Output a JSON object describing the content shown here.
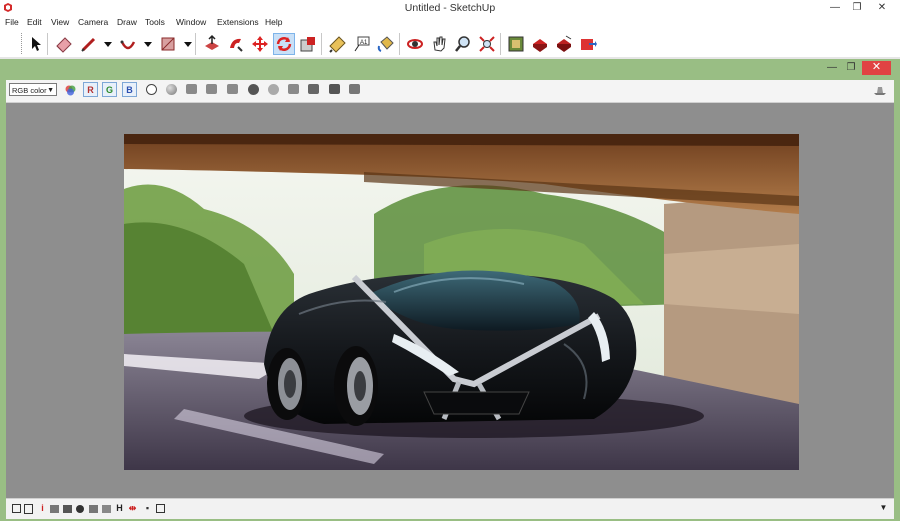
{
  "window": {
    "title": "Untitled - SketchUp",
    "minimize": "—",
    "restore": "❐",
    "close": "✕"
  },
  "menu": [
    "File",
    "Edit",
    "View",
    "Camera",
    "Draw",
    "Tools",
    "Window",
    "Extensions",
    "Help"
  ],
  "toolbar": {
    "tools": [
      "select",
      "eraser",
      "line",
      "arc",
      "rectangle",
      "push-pull",
      "follow-me",
      "move",
      "rotate",
      "scale",
      "tape-measure",
      "text",
      "paint-bucket",
      "orbit",
      "pan",
      "zoom",
      "zoom-extents",
      "warehouse",
      "share-model",
      "components",
      "extension-warehouse"
    ],
    "active": "rotate"
  },
  "child_window": {
    "minimize": "—",
    "restore": "❐",
    "close": "✕"
  },
  "color_toolbar": {
    "mode_select": "RGB color",
    "channels": [
      "R",
      "G",
      "B"
    ]
  },
  "status_icons": [
    "H"
  ],
  "colors": {
    "child_frame": "#99be84",
    "workspace": "#8e8e8e",
    "active_tool": "#c9e0f7",
    "close_red": "#e04343"
  }
}
